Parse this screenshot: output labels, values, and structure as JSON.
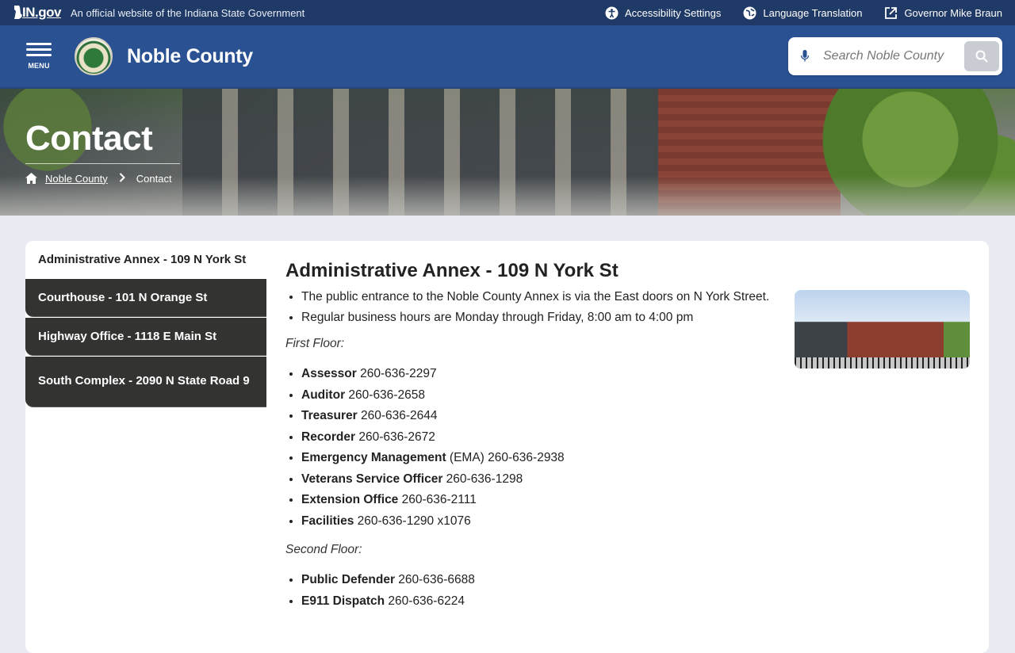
{
  "statebar": {
    "logo": "IN.gov",
    "official": "An official website of the Indiana State Government",
    "links": [
      {
        "label": "Accessibility Settings"
      },
      {
        "label": "Language Translation"
      },
      {
        "label": "Governor Mike Braun"
      }
    ]
  },
  "header": {
    "menu_label": "MENU",
    "site_title": "Noble County",
    "search_placeholder": "Search Noble County"
  },
  "hero": {
    "title": "Contact",
    "breadcrumb": {
      "home": "Noble County",
      "current": "Contact"
    }
  },
  "sidenav": {
    "items": [
      "Administrative Annex - 109 N York St",
      "Courthouse - 101 N Orange St",
      "Highway Office - 1118 E Main St",
      "South Complex - 2090 N State Road 9"
    ]
  },
  "content": {
    "title": "Administrative Annex - 109 N York St",
    "bullets": [
      "The public entrance to the Noble County Annex is via the East doors on N York Street.",
      "Regular business hours are Monday through Friday, 8:00 am to 4:00 pm"
    ],
    "first_floor_label": "First Floor:",
    "first_floor": [
      {
        "dept": "Assessor",
        "rest": " 260-636-2297"
      },
      {
        "dept": "Auditor",
        "rest": " 260-636-2658"
      },
      {
        "dept": "Treasurer",
        "rest": " 260-636-2644"
      },
      {
        "dept": "Recorder",
        "rest": " 260-636-2672"
      },
      {
        "dept": "Emergency Management",
        "rest": " (EMA) 260-636-2938"
      },
      {
        "dept": "Veterans Service Officer",
        "rest": " 260-636-1298"
      },
      {
        "dept": "Extension Office",
        "rest": " 260-636-2111"
      },
      {
        "dept": "Facilities",
        "rest": " 260-636-1290 x1076"
      }
    ],
    "second_floor_label": "Second Floor:",
    "second_floor": [
      {
        "dept": "Public Defender",
        "rest": " 260-636-6688"
      },
      {
        "dept": "E911 Dispatch",
        "rest": " 260-636-6224"
      }
    ]
  }
}
